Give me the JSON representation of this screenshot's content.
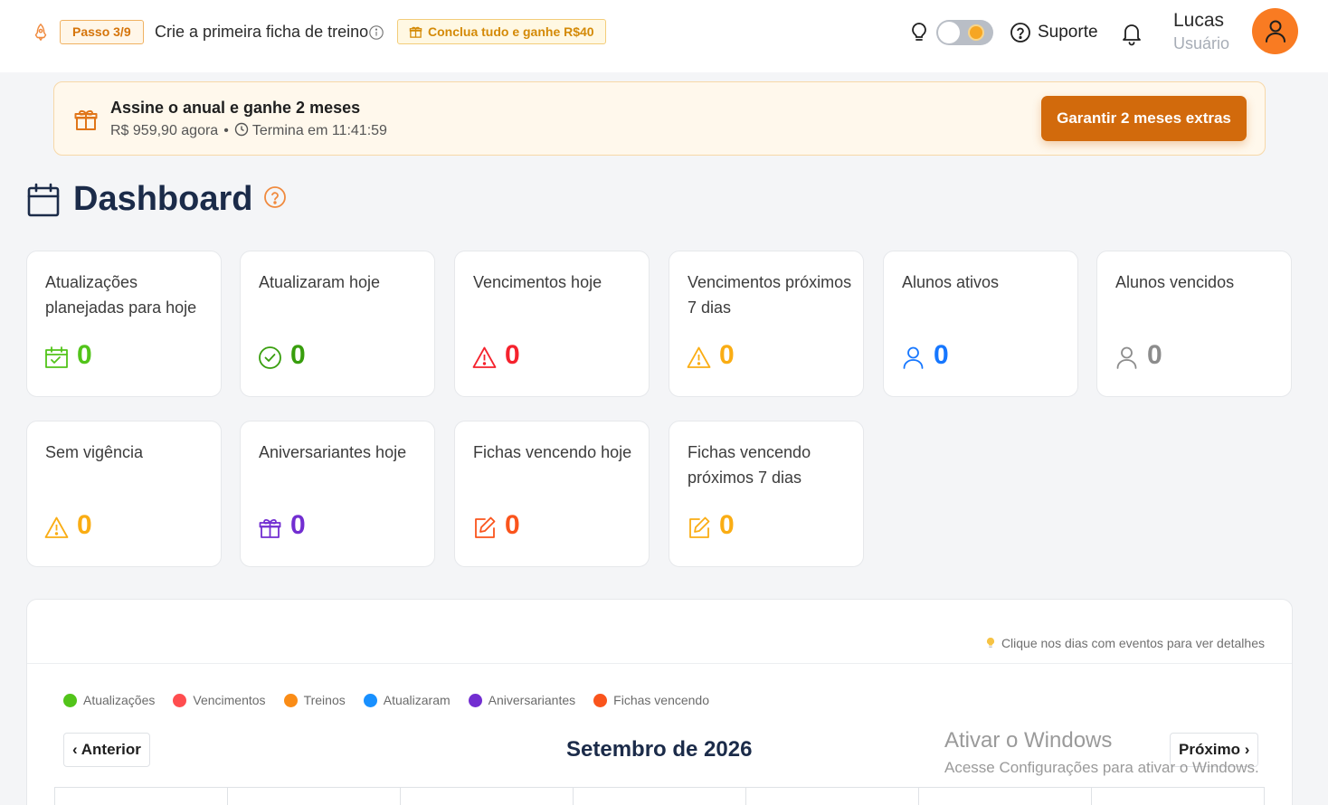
{
  "topbar": {
    "step_badge": "Passo 3/9",
    "step_text": "Crie a primeira ficha de treino",
    "reward_badge": "Conclua tudo e ganhe R$40",
    "support_label": "Suporte",
    "user_name": "Lucas",
    "user_role": "Usuário",
    "icons": [
      "rocket-icon",
      "info-icon",
      "gift-icon",
      "bulb-icon",
      "question-icon",
      "bell-icon",
      "user-icon"
    ]
  },
  "promo": {
    "title": "Assine o anual e ganhe 2 meses",
    "price": "R$ 959,90 agora",
    "separator": "•",
    "timer": "Termina em 11:41:59",
    "button": "Garantir 2 meses extras"
  },
  "page": {
    "title": "Dashboard"
  },
  "cards": [
    {
      "label": "Atualizações planejadas para hoje",
      "value": "0",
      "icon": "calendar-check-icon",
      "color": "#52c41a"
    },
    {
      "label": "Atualizaram hoje",
      "value": "0",
      "icon": "check-circle-icon",
      "color": "#389e0d"
    },
    {
      "label": "Vencimentos hoje",
      "value": "0",
      "icon": "warning-icon",
      "color": "#f5222d"
    },
    {
      "label": "Vencimentos próximos 7 dias",
      "value": "0",
      "icon": "warning-icon",
      "color": "#faad14"
    },
    {
      "label": "Alunos ativos",
      "value": "0",
      "icon": "user-icon",
      "color": "#1677ff"
    },
    {
      "label": "Alunos vencidos",
      "value": "0",
      "icon": "user-icon",
      "color": "#8c8c8c"
    },
    {
      "label": "Sem vigência",
      "value": "0",
      "icon": "warning-icon",
      "color": "#faad14"
    },
    {
      "label": "Aniversariantes hoje",
      "value": "0",
      "icon": "gift-icon",
      "color": "#722ed1"
    },
    {
      "label": "Fichas vencendo hoje",
      "value": "0",
      "icon": "edit-icon",
      "color": "#fa541c"
    },
    {
      "label": "Fichas vencendo próximos 7 dias",
      "value": "0",
      "icon": "edit-icon",
      "color": "#faad14"
    }
  ],
  "calendar": {
    "hint": "Clique nos dias com eventos para ver detalhes",
    "legend": [
      {
        "label": "Atualizações",
        "color": "#52c41a"
      },
      {
        "label": "Vencimentos",
        "color": "#ff4d4f"
      },
      {
        "label": "Treinos",
        "color": "#fa8c16"
      },
      {
        "label": "Atualizaram",
        "color": "#1890ff"
      },
      {
        "label": "Aniversariantes",
        "color": "#722ed1"
      },
      {
        "label": "Fichas vencendo",
        "color": "#fa541c"
      }
    ],
    "prev": "‹ Anterior",
    "next": "Próximo ›",
    "month": "Setembro de 2026"
  },
  "watermark": {
    "line1": "Ativar o Windows",
    "line2": "Acesse Configurações para ativar o Windows."
  }
}
